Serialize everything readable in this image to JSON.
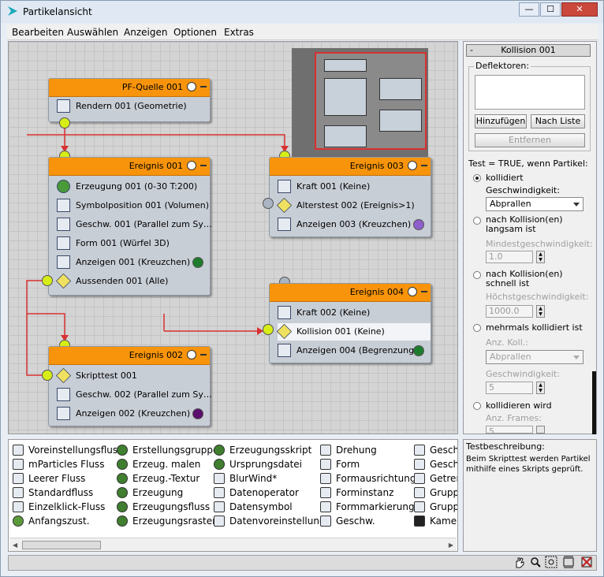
{
  "window": {
    "title": "Partikelansicht",
    "min": "—",
    "max": "☐",
    "close": "✕"
  },
  "menu": [
    "Bearbeiten",
    "Auswählen",
    "Anzeigen",
    "Optionen",
    "Extras"
  ],
  "nodes": {
    "pf_source": {
      "title": "PF-Quelle 001",
      "ops": [
        "Rendern 001 (Geometrie)"
      ]
    },
    "event1": {
      "title": "Ereignis 001",
      "ops": [
        "Erzeugung 001 (0-30 T:200)",
        "Symbolposition 001 (Volumen)",
        "Geschw. 001 (Parallel zum Sy…",
        "Form 001 (Würfel 3D)",
        "Anzeigen 001 (Kreuzchen)",
        "Aussenden 001 (Alle)"
      ]
    },
    "event2": {
      "title": "Ereignis 002",
      "ops": [
        "Skripttest 001",
        "Geschw. 002 (Parallel zum Sy…",
        "Anzeigen 002 (Kreuzchen)"
      ]
    },
    "event3": {
      "title": "Ereignis 003",
      "ops": [
        "Kraft 001 (Keine)",
        "Alterstest 002 (Ereignis>1)",
        "Anzeigen 003 (Kreuzchen)"
      ]
    },
    "event4": {
      "title": "Ereignis 004",
      "ops": [
        "Kraft 002 (Keine)",
        "Kollision 001 (Keine)",
        "Anzeigen 004 (Begrenzung…"
      ]
    }
  },
  "colors": {
    "node_header": "#f7940b",
    "wire": "#d83030",
    "port": "#d6ee16"
  },
  "panel": {
    "rollout_minus": "-",
    "rollout_title": "Kollision 001",
    "deflectors_label": "Deflektoren:",
    "add_button": "Hinzufügen",
    "by_list_button": "Nach Liste",
    "remove_button": "Entfernen",
    "test_label": "Test = TRUE, wenn Partikel:",
    "opt_collided": "kollidiert",
    "speed_label": "Geschwindigkeit:",
    "speed_value": "Abprallen",
    "opt_slow": "nach Kollision(en) langsam ist",
    "min_speed_label": "Mindestgeschwindigkeit:",
    "min_speed_value": "1.0",
    "opt_fast": "nach Kollision(en) schnell ist",
    "max_speed_label": "Höchstgeschwindigkeit:",
    "max_speed_value": "1000.0",
    "opt_multi": "mehrmals kollidiert ist",
    "num_coll_label": "Anz. Koll.:",
    "multi_speed_value": "Abprallen",
    "speed2_label": "Geschwindigkeit:",
    "speed2_value": "5",
    "opt_will": "kollidieren wird",
    "frames_label": "Anz. Frames:",
    "frames_value": "5"
  },
  "depot": {
    "col1": [
      "Voreinstellungsfluss",
      "mParticles Fluss",
      "Leerer Fluss",
      "Standardfluss",
      "Einzelklick-Fluss",
      "Anfangszust."
    ],
    "col2": [
      "Erstellungsgruppe",
      "Erzeug. malen",
      "Erzeug.-Textur",
      "Erzeugung",
      "Erzeugungsfluss",
      "Erzeugungsraster"
    ],
    "col3": [
      "Erzeugungsskript",
      "Ursprungsdatei",
      "BlurWind*",
      "Datenoperator",
      "Datensymbol",
      "Datenvoreinstellung"
    ],
    "col4": [
      "Drehung",
      "Form",
      "Formausrichtung",
      "Forminstanz",
      "Formmarkierung",
      "Geschw."
    ],
    "col5": [
      "Geschw",
      "Geschw",
      "Getren",
      "Grupp",
      "Grupp",
      "Kamer"
    ]
  },
  "description": {
    "title": "Testbeschreibung:",
    "text": "Beim Skripttest werden Partikel mithilfe eines Skripts geprüft."
  },
  "status_icons": [
    "hand-icon",
    "zoom-icon",
    "zoom-region-icon",
    "zoom-extents-icon",
    "no-zoom-icon"
  ]
}
